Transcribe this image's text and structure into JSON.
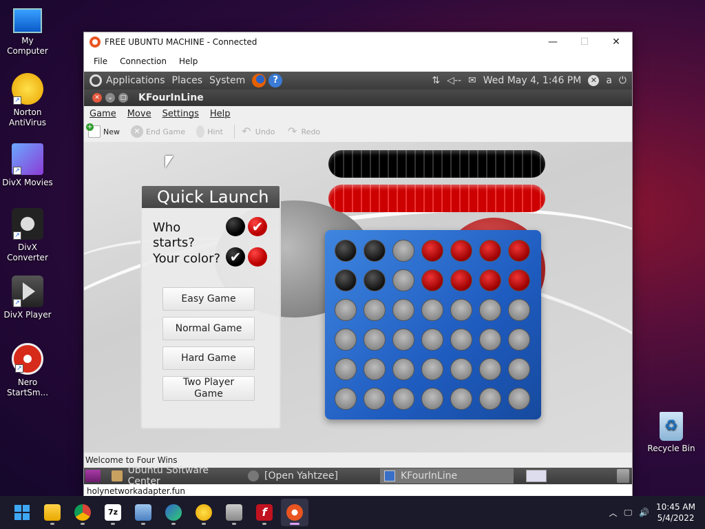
{
  "desktop": {
    "icons": [
      {
        "label": "My Computer"
      },
      {
        "label": "Norton AntiVirus"
      },
      {
        "label": "DivX Movies"
      },
      {
        "label": "DivX Converter"
      },
      {
        "label": "DivX Player"
      },
      {
        "label": "Nero StartSm..."
      },
      {
        "label": "Recycle Bin"
      }
    ]
  },
  "vm": {
    "title": "FREE UBUNTU MACHINE - Connected",
    "menu": [
      "File",
      "Connection",
      "Help"
    ],
    "status_text": "holynetworkadapter.fun"
  },
  "ubuntu_panel": {
    "menus": [
      "Applications",
      "Places",
      "System"
    ],
    "clock": "Wed May  4,  1:46 PM",
    "user": "a"
  },
  "kfour": {
    "title": "KFourInLine",
    "menu": [
      "Game",
      "Move",
      "Settings",
      "Help"
    ],
    "toolbar": [
      {
        "label": "New",
        "enabled": true,
        "icon": "new-game-icon"
      },
      {
        "label": "End Game",
        "enabled": false,
        "icon": "end-game-icon"
      },
      {
        "label": "Hint",
        "enabled": false,
        "icon": "hint-bulb-icon"
      },
      {
        "label": "Undo",
        "enabled": false,
        "icon": "undo-icon"
      },
      {
        "label": "Redo",
        "enabled": false,
        "icon": "redo-icon"
      }
    ],
    "quick_launch": {
      "title": "Quick Launch",
      "who_starts_line1": "Who",
      "who_starts_line2": "starts?",
      "your_color": "Your color?",
      "buttons": [
        "Easy Game",
        "Normal Game",
        "Hard Game",
        "Two Player Game"
      ]
    },
    "board": [
      [
        "black",
        "black",
        "gray",
        "red",
        "red",
        "red",
        "red"
      ],
      [
        "black",
        "black",
        "gray",
        "red",
        "red",
        "red",
        "red"
      ],
      [
        "gray",
        "gray",
        "gray",
        "gray",
        "gray",
        "gray",
        "gray"
      ],
      [
        "gray",
        "gray",
        "gray",
        "gray",
        "gray",
        "gray",
        "gray"
      ],
      [
        "gray",
        "gray",
        "gray",
        "gray",
        "gray",
        "gray",
        "gray"
      ],
      [
        "gray",
        "gray",
        "gray",
        "gray",
        "gray",
        "gray",
        "gray"
      ]
    ],
    "status": "Welcome to Four Wins"
  },
  "ubuntu_bottom": {
    "tasks": [
      {
        "label": "Ubuntu Software Center",
        "active": false
      },
      {
        "label": "[Open Yahtzee]",
        "active": false
      },
      {
        "label": "KFourInLine",
        "active": true
      }
    ]
  },
  "taskbar": {
    "apps": [
      "start-icon",
      "file-explorer-icon",
      "chrome-icon",
      "7zip-icon",
      "network-icon",
      "edge-icon",
      "norton-icon",
      "installer-icon",
      "flash-icon",
      "ubuntu-vm-icon"
    ],
    "time": "10:45 AM",
    "date": "5/4/2022"
  },
  "colors": {
    "ubuntu_orange": "#e95420",
    "board_blue": "#2a6fd6",
    "piece_red": "#cc0000",
    "piece_black": "#000000"
  }
}
